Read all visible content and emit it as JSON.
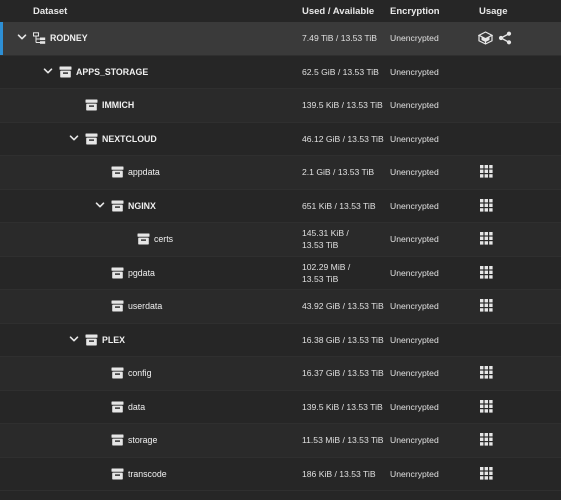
{
  "header": {
    "dataset": "Dataset",
    "used_available": "Used / Available",
    "encryption": "Encryption",
    "usage": "Usage"
  },
  "rows": [
    {
      "name": "RODNEY",
      "used": "7.49 TiB / 13.53 TiB",
      "encryption": "Unencrypted",
      "level": 0,
      "expanded": true,
      "kind": "pool",
      "usage": [
        "apps-icon",
        "share-icon"
      ],
      "selected": true
    },
    {
      "name": "APPS_STORAGE",
      "used": "62.5 GiB / 13.53 TiB",
      "encryption": "Unencrypted",
      "level": 1,
      "expanded": true,
      "kind": "dataset",
      "usage": []
    },
    {
      "name": "IMMICH",
      "used": "139.5 KiB / 13.53 TiB",
      "encryption": "Unencrypted",
      "level": 2,
      "expanded": null,
      "kind": "dataset",
      "usage": []
    },
    {
      "name": "NEXTCLOUD",
      "used": "46.12 GiB / 13.53 TiB",
      "encryption": "Unencrypted",
      "level": 2,
      "expanded": true,
      "kind": "dataset",
      "usage": []
    },
    {
      "name": "appdata",
      "used": "2.1 GiB / 13.53 TiB",
      "encryption": "Unencrypted",
      "level": 3,
      "expanded": null,
      "kind": "dataset",
      "usage": [
        "grid-icon"
      ]
    },
    {
      "name": "NGINX",
      "used": "651 KiB / 13.53 TiB",
      "encryption": "Unencrypted",
      "level": 3,
      "expanded": true,
      "kind": "dataset",
      "usage": [
        "grid-icon"
      ]
    },
    {
      "name": "certs",
      "used_lines": [
        "145.31 KiB /",
        "13.53 TiB"
      ],
      "encryption": "Unencrypted",
      "level": 4,
      "expanded": null,
      "kind": "dataset",
      "usage": [
        "grid-icon"
      ]
    },
    {
      "name": "pgdata",
      "used_lines": [
        "102.29 MiB /",
        "13.53 TiB"
      ],
      "encryption": "Unencrypted",
      "level": 3,
      "expanded": null,
      "kind": "dataset",
      "usage": [
        "grid-icon"
      ]
    },
    {
      "name": "userdata",
      "used": "43.92 GiB / 13.53 TiB",
      "encryption": "Unencrypted",
      "level": 3,
      "expanded": null,
      "kind": "dataset",
      "usage": [
        "grid-icon"
      ]
    },
    {
      "name": "PLEX",
      "used": "16.38 GiB / 13.53 TiB",
      "encryption": "Unencrypted",
      "level": 2,
      "expanded": true,
      "kind": "dataset",
      "usage": []
    },
    {
      "name": "config",
      "used": "16.37 GiB / 13.53 TiB",
      "encryption": "Unencrypted",
      "level": 3,
      "expanded": null,
      "kind": "dataset",
      "usage": [
        "grid-icon"
      ]
    },
    {
      "name": "data",
      "used": "139.5 KiB / 13.53 TiB",
      "encryption": "Unencrypted",
      "level": 3,
      "expanded": null,
      "kind": "dataset",
      "usage": [
        "grid-icon"
      ]
    },
    {
      "name": "storage",
      "used": "11.53 MiB / 13.53 TiB",
      "encryption": "Unencrypted",
      "level": 3,
      "expanded": null,
      "kind": "dataset",
      "usage": [
        "grid-icon"
      ]
    },
    {
      "name": "transcode",
      "used": "186 KiB / 13.53 TiB",
      "encryption": "Unencrypted",
      "level": 3,
      "expanded": null,
      "kind": "dataset",
      "usage": [
        "grid-icon"
      ]
    }
  ],
  "colors": {
    "selection_accent": "#2d8fd5",
    "background": "#262626",
    "text": "#e6e6e6"
  }
}
